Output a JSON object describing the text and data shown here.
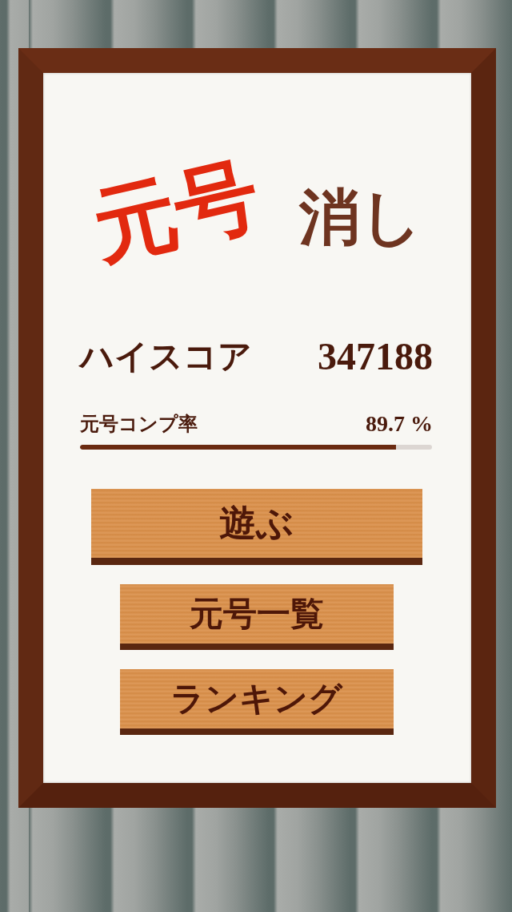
{
  "title": {
    "stamp": "元号",
    "suffix": "消し"
  },
  "high_score": {
    "label": "ハイスコア",
    "value": "347188"
  },
  "completion": {
    "label": "元号コンプ率",
    "value": "89.7 %",
    "level": 0.897
  },
  "buttons": [
    {
      "label": "遊ぶ",
      "kind": "primary"
    },
    {
      "label": "元号一覧",
      "kind": "secondary"
    },
    {
      "label": "ランキング",
      "kind": "secondary"
    }
  ]
}
